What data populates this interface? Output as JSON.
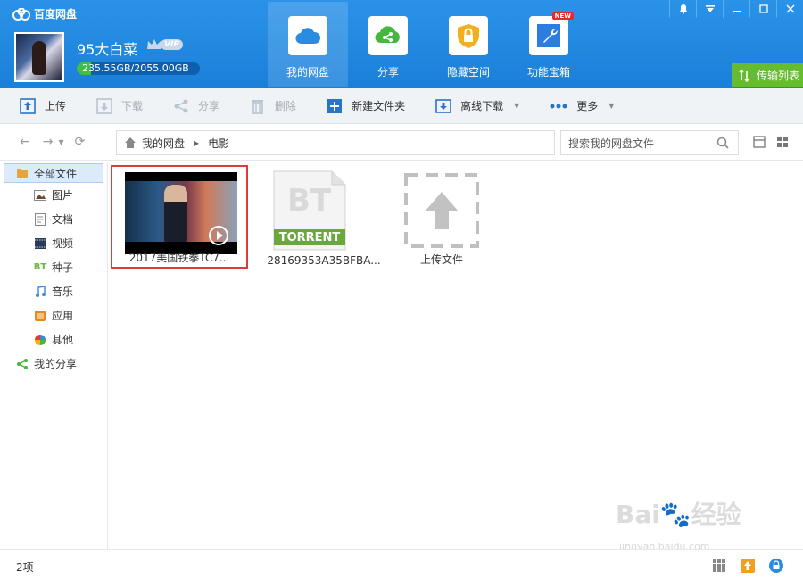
{
  "app": {
    "title": "百度网盘"
  },
  "user": {
    "name": "95大白菜",
    "vip_label": "VIP",
    "quota_text": "235.55GB/2055.00GB",
    "quota_fraction": 0.115
  },
  "nav": [
    {
      "label": "我的网盘",
      "icon": "cloud-icon",
      "active": true
    },
    {
      "label": "分享",
      "icon": "share-icon"
    },
    {
      "label": "隐藏空间",
      "icon": "lock-icon"
    },
    {
      "label": "功能宝箱",
      "icon": "wrench-icon",
      "badge": "NEW"
    }
  ],
  "transfer": {
    "label": "传输列表"
  },
  "toolbar": {
    "upload": "上传",
    "download": "下载",
    "share": "分享",
    "delete": "删除",
    "new_folder": "新建文件夹",
    "offline_download": "离线下载",
    "more": "更多"
  },
  "breadcrumb": {
    "root": "我的网盘",
    "current": "电影"
  },
  "search": {
    "placeholder": "搜索我的网盘文件"
  },
  "sidebar": {
    "all_files": "全部文件",
    "items": [
      {
        "label": "图片",
        "icon": "image-icon"
      },
      {
        "label": "文档",
        "icon": "document-icon"
      },
      {
        "label": "视频",
        "icon": "video-icon"
      },
      {
        "label": "种子",
        "icon": "bt-icon",
        "icon_text": "BT"
      },
      {
        "label": "音乐",
        "icon": "music-icon"
      },
      {
        "label": "应用",
        "icon": "app-icon"
      },
      {
        "label": "其他",
        "icon": "other-icon"
      }
    ],
    "my_share": "我的分享"
  },
  "files": [
    {
      "name": "2017美国铁拳TC7...",
      "type": "video",
      "selected": true
    },
    {
      "name": "28169353A35BFBA...",
      "type": "torrent",
      "icon_text": "BT",
      "tag": "TORRENT"
    },
    {
      "name": "上传文件",
      "type": "upload"
    }
  ],
  "status": {
    "count": "2项"
  },
  "watermark": {
    "brand": "Bai",
    "brand2": "经验",
    "sub": "jingyan.baidu.com"
  },
  "colors": {
    "header": "#1f88e0",
    "accent_green": "#66bb30",
    "selection": "#e03a3a"
  }
}
